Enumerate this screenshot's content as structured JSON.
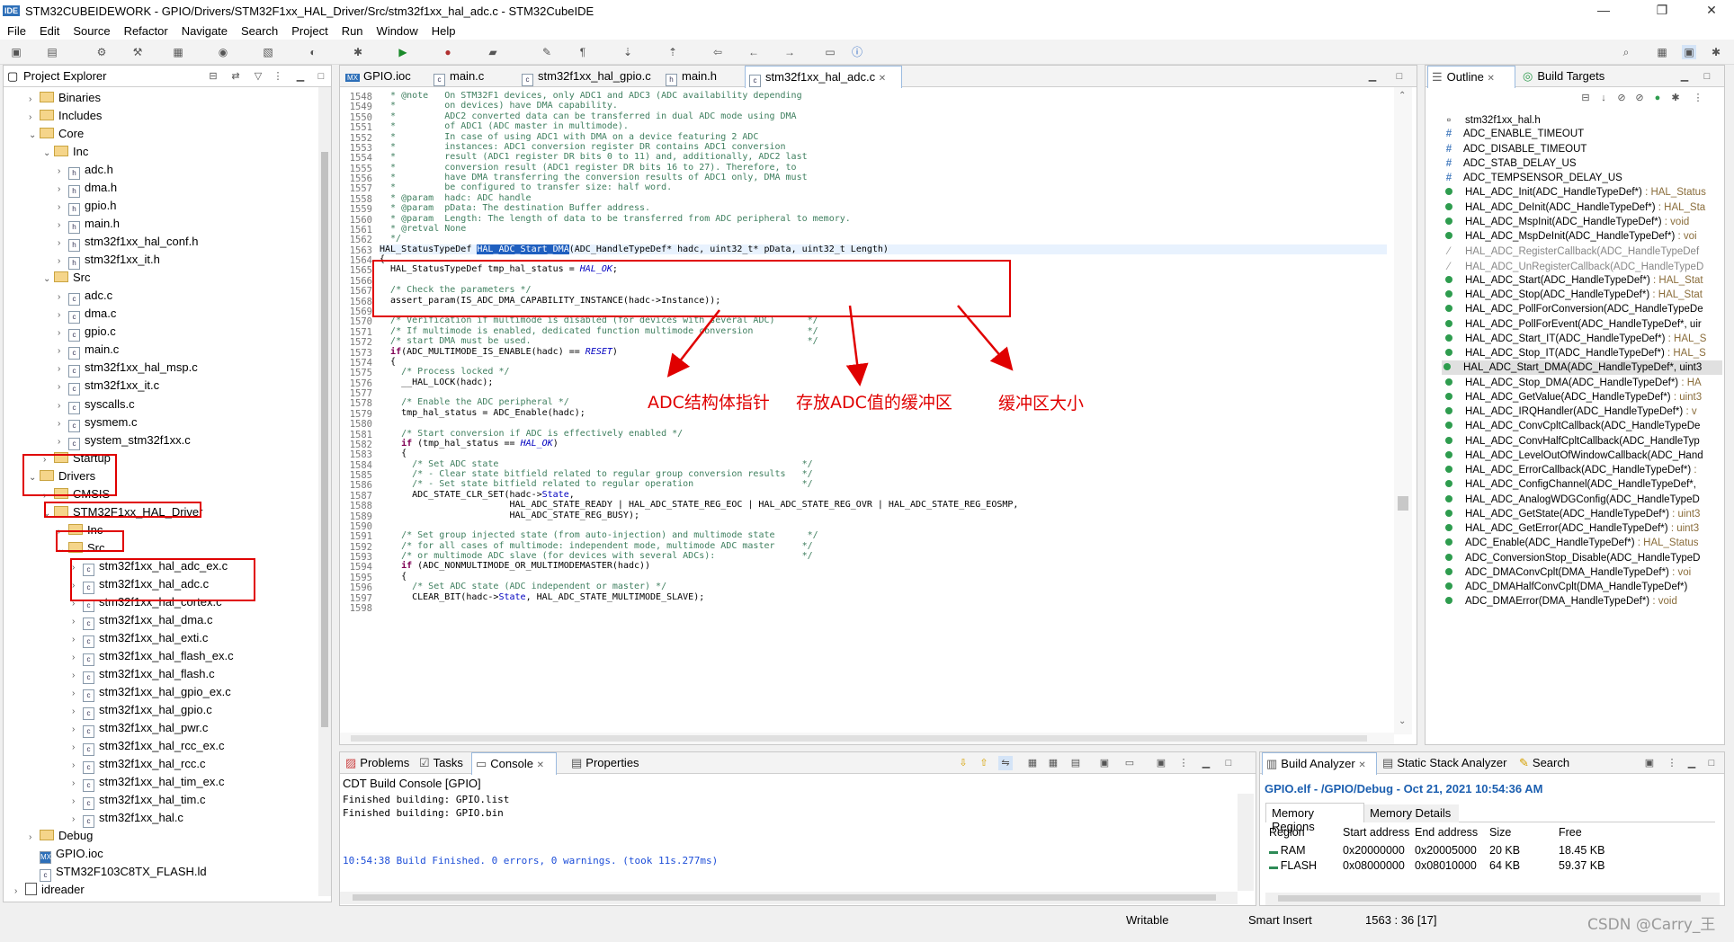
{
  "window": {
    "ide_badge": "IDE",
    "title": "STM32CUBEIDEWORK - GPIO/Drivers/STM32F1xx_HAL_Driver/Src/stm32f1xx_hal_adc.c - STM32CubeIDE",
    "minimize": "—",
    "restore": "❐",
    "close": "✕"
  },
  "menu": [
    "File",
    "Edit",
    "Source",
    "Refactor",
    "Navigate",
    "Search",
    "Project",
    "Run",
    "Window",
    "Help"
  ],
  "project_explorer": {
    "title": "Project Explorer",
    "items": [
      {
        "label": "Binaries",
        "depth": 1,
        "kind": "folder",
        "tw": "›"
      },
      {
        "label": "Includes",
        "depth": 1,
        "kind": "folder",
        "tw": "›"
      },
      {
        "label": "Core",
        "depth": 1,
        "kind": "folder",
        "tw": "⌄"
      },
      {
        "label": "Inc",
        "depth": 2,
        "kind": "folder",
        "tw": "⌄"
      },
      {
        "label": "adc.h",
        "depth": 3,
        "kind": "h",
        "tw": "›"
      },
      {
        "label": "dma.h",
        "depth": 3,
        "kind": "h",
        "tw": "›"
      },
      {
        "label": "gpio.h",
        "depth": 3,
        "kind": "h",
        "tw": "›"
      },
      {
        "label": "main.h",
        "depth": 3,
        "kind": "h",
        "tw": "›"
      },
      {
        "label": "stm32f1xx_hal_conf.h",
        "depth": 3,
        "kind": "h",
        "tw": "›"
      },
      {
        "label": "stm32f1xx_it.h",
        "depth": 3,
        "kind": "h",
        "tw": "›"
      },
      {
        "label": "Src",
        "depth": 2,
        "kind": "folder",
        "tw": "⌄"
      },
      {
        "label": "adc.c",
        "depth": 3,
        "kind": "c",
        "tw": "›"
      },
      {
        "label": "dma.c",
        "depth": 3,
        "kind": "c",
        "tw": "›"
      },
      {
        "label": "gpio.c",
        "depth": 3,
        "kind": "c",
        "tw": "›"
      },
      {
        "label": "main.c",
        "depth": 3,
        "kind": "c",
        "tw": "›"
      },
      {
        "label": "stm32f1xx_hal_msp.c",
        "depth": 3,
        "kind": "c",
        "tw": "›"
      },
      {
        "label": "stm32f1xx_it.c",
        "depth": 3,
        "kind": "c",
        "tw": "›"
      },
      {
        "label": "syscalls.c",
        "depth": 3,
        "kind": "c",
        "tw": "›"
      },
      {
        "label": "sysmem.c",
        "depth": 3,
        "kind": "c",
        "tw": "›"
      },
      {
        "label": "system_stm32f1xx.c",
        "depth": 3,
        "kind": "c",
        "tw": "›"
      },
      {
        "label": "Startup",
        "depth": 2,
        "kind": "folder",
        "tw": "›"
      },
      {
        "label": "Drivers",
        "depth": 1,
        "kind": "folder",
        "tw": "⌄"
      },
      {
        "label": "CMSIS",
        "depth": 2,
        "kind": "folder",
        "tw": "›"
      },
      {
        "label": "STM32F1xx_HAL_Driver",
        "depth": 2,
        "kind": "folder",
        "tw": "⌄"
      },
      {
        "label": "Inc",
        "depth": 3,
        "kind": "folder",
        "tw": "›"
      },
      {
        "label": "Src",
        "depth": 3,
        "kind": "folder",
        "tw": "⌄"
      },
      {
        "label": "stm32f1xx_hal_adc_ex.c",
        "depth": 4,
        "kind": "c",
        "tw": "›"
      },
      {
        "label": "stm32f1xx_hal_adc.c",
        "depth": 4,
        "kind": "c",
        "tw": "›"
      },
      {
        "label": "stm32f1xx_hal_cortex.c",
        "depth": 4,
        "kind": "c",
        "tw": "›"
      },
      {
        "label": "stm32f1xx_hal_dma.c",
        "depth": 4,
        "kind": "c",
        "tw": "›"
      },
      {
        "label": "stm32f1xx_hal_exti.c",
        "depth": 4,
        "kind": "c",
        "tw": "›"
      },
      {
        "label": "stm32f1xx_hal_flash_ex.c",
        "depth": 4,
        "kind": "c",
        "tw": "›"
      },
      {
        "label": "stm32f1xx_hal_flash.c",
        "depth": 4,
        "kind": "c",
        "tw": "›"
      },
      {
        "label": "stm32f1xx_hal_gpio_ex.c",
        "depth": 4,
        "kind": "c",
        "tw": "›"
      },
      {
        "label": "stm32f1xx_hal_gpio.c",
        "depth": 4,
        "kind": "c",
        "tw": "›"
      },
      {
        "label": "stm32f1xx_hal_pwr.c",
        "depth": 4,
        "kind": "c",
        "tw": "›"
      },
      {
        "label": "stm32f1xx_hal_rcc_ex.c",
        "depth": 4,
        "kind": "c",
        "tw": "›"
      },
      {
        "label": "stm32f1xx_hal_rcc.c",
        "depth": 4,
        "kind": "c",
        "tw": "›"
      },
      {
        "label": "stm32f1xx_hal_tim_ex.c",
        "depth": 4,
        "kind": "c",
        "tw": "›"
      },
      {
        "label": "stm32f1xx_hal_tim.c",
        "depth": 4,
        "kind": "c",
        "tw": "›"
      },
      {
        "label": "stm32f1xx_hal.c",
        "depth": 4,
        "kind": "c",
        "tw": "›"
      },
      {
        "label": "Debug",
        "depth": 1,
        "kind": "folder",
        "tw": "›"
      },
      {
        "label": "GPIO.ioc",
        "depth": 1,
        "kind": "mx",
        "tw": ""
      },
      {
        "label": "STM32F103C8TX_FLASH.ld",
        "depth": 1,
        "kind": "c",
        "tw": ""
      },
      {
        "label": "idreader",
        "depth": 0,
        "kind": "project",
        "tw": "›"
      }
    ]
  },
  "editor": {
    "tabs": [
      {
        "icon": "MX",
        "label": "GPIO.ioc"
      },
      {
        "icon": "c",
        "label": "main.c"
      },
      {
        "icon": "c",
        "label": "stm32f1xx_hal_gpio.c"
      },
      {
        "icon": "h",
        "label": "main.h"
      },
      {
        "icon": "c",
        "label": "stm32f1xx_hal_adc.c",
        "close": "✕"
      }
    ],
    "lines": [
      {
        "n": "1548",
        "html": "<span class='c'>  * @note   On STM32F1 devices, only ADC1 and ADC3 (ADC availability depending</span>"
      },
      {
        "n": "1549",
        "html": "<span class='c'>  *         on devices) have DMA capability.</span>"
      },
      {
        "n": "1550",
        "html": "<span class='c'>  *         ADC2 converted data can be transferred in dual ADC mode using DMA</span>"
      },
      {
        "n": "1551",
        "html": "<span class='c'>  *         of ADC1 (ADC master in multimode).</span>"
      },
      {
        "n": "1552",
        "html": "<span class='c'>  *         In case of using ADC1 with DMA on a device featuring 2 ADC</span>"
      },
      {
        "n": "1553",
        "html": "<span class='c'>  *         instances: ADC1 conversion register DR contains ADC1 conversion</span>"
      },
      {
        "n": "1554",
        "html": "<span class='c'>  *         result (ADC1 register DR bits 0 to 11) and, additionally, ADC2 last</span>"
      },
      {
        "n": "1555",
        "html": "<span class='c'>  *         conversion result (ADC1 register DR bits 16 to 27). Therefore, to</span>"
      },
      {
        "n": "1556",
        "html": "<span class='c'>  *         have DMA transferring the conversion results of ADC1 only, DMA must</span>"
      },
      {
        "n": "1557",
        "html": "<span class='c'>  *         be configured to transfer size: half word.</span>"
      },
      {
        "n": "1558",
        "html": "<span class='c'>  * @param  hadc: ADC handle</span>"
      },
      {
        "n": "1559",
        "html": "<span class='c'>  * @param  pData: The destination Buffer address.</span>"
      },
      {
        "n": "1560",
        "html": "<span class='c'>  * @param  Length: The length of data to be transferred from ADC peripheral to memory.</span>"
      },
      {
        "n": "1561",
        "html": "<span class='c'>  * @retval None</span>"
      },
      {
        "n": "1562",
        "html": "<span class='c'>  */</span>"
      },
      {
        "n": "1563",
        "html": "HAL_StatusTypeDef <span style='background:#1f5fbf;color:#fff'>HAL_ADC_Start_DMA</span>(ADC_HandleTypeDef* hadc, uint32_t* pData, uint32_t Length)"
      },
      {
        "n": "1564",
        "html": "{"
      },
      {
        "n": "1565",
        "html": "  HAL_StatusTypeDef tmp_hal_status = <span class='m'>HAL_OK</span>;"
      },
      {
        "n": "1566",
        "html": ""
      },
      {
        "n": "1567",
        "html": "  <span class='c'>/* Check the parameters */</span>"
      },
      {
        "n": "1568",
        "html": "  assert_param(IS_ADC_DMA_CAPABILITY_INSTANCE(hadc-&gt;Instance));"
      },
      {
        "n": "1569",
        "html": ""
      },
      {
        "n": "1570",
        "html": "  <span class='c'>/* Verification if multimode is disabled (for devices with several ADC)      */</span>"
      },
      {
        "n": "1571",
        "html": "  <span class='c'>/* If multimode is enabled, dedicated function multimode conversion          */</span>"
      },
      {
        "n": "1572",
        "html": "  <span class='c'>/* start DMA must be used.                                                   */</span>"
      },
      {
        "n": "1573",
        "html": "  <span class='k'>if</span>(ADC_MULTIMODE_IS_ENABLE(hadc) == <span class='m'>RESET</span>)"
      },
      {
        "n": "1574",
        "html": "  {"
      },
      {
        "n": "1575",
        "html": "    <span class='c'>/* Process locked */</span>"
      },
      {
        "n": "1576",
        "html": "    __HAL_LOCK(hadc);"
      },
      {
        "n": "1577",
        "html": ""
      },
      {
        "n": "1578",
        "html": "    <span class='c'>/* Enable the ADC peripheral */</span>"
      },
      {
        "n": "1579",
        "html": "    tmp_hal_status = ADC_Enable(hadc);"
      },
      {
        "n": "1580",
        "html": ""
      },
      {
        "n": "1581",
        "html": "    <span class='c'>/* Start conversion if ADC is effectively enabled */</span>"
      },
      {
        "n": "1582",
        "html": "    <span class='k'>if</span> (tmp_hal_status == <span class='m'>HAL_OK</span>)"
      },
      {
        "n": "1583",
        "html": "    {"
      },
      {
        "n": "1584",
        "html": "      <span class='c'>/* Set ADC state                                                        */</span>"
      },
      {
        "n": "1585",
        "html": "      <span class='c'>/* - Clear state bitfield related to regular group conversion results   */</span>"
      },
      {
        "n": "1586",
        "html": "      <span class='c'>/* - Set state bitfield related to regular operation                    */</span>"
      },
      {
        "n": "1587",
        "html": "      ADC_STATE_CLR_SET(hadc-&gt;<span style='color:#0000c0'>State</span>,"
      },
      {
        "n": "1588",
        "html": "                        HAL_ADC_STATE_READY | HAL_ADC_STATE_REG_EOC | HAL_ADC_STATE_REG_OVR | HAL_ADC_STATE_REG_EOSMP,"
      },
      {
        "n": "1589",
        "html": "                        HAL_ADC_STATE_REG_BUSY);"
      },
      {
        "n": "1590",
        "html": ""
      },
      {
        "n": "1591",
        "html": "    <span class='c'>/* Set group injected state (from auto-injection) and multimode state      */</span>"
      },
      {
        "n": "1592",
        "html": "    <span class='c'>/* for all cases of multimode: independent mode, multimode ADC master     */</span>"
      },
      {
        "n": "1593",
        "html": "    <span class='c'>/* or multimode ADC slave (for devices with several ADCs):                */</span>"
      },
      {
        "n": "1594",
        "html": "    <span class='k'>if</span> (ADC_NONMULTIMODE_OR_MULTIMODEMASTER(hadc))"
      },
      {
        "n": "1595",
        "html": "    {"
      },
      {
        "n": "1596",
        "html": "      <span class='c'>/* Set ADC state (ADC independent or master) */</span>"
      },
      {
        "n": "1597",
        "html": "      CLEAR_BIT(hadc-&gt;<span style='color:#0000c0'>State</span>, HAL_ADC_STATE_MULTIMODE_SLAVE);"
      },
      {
        "n": "1598",
        "html": ""
      }
    ]
  },
  "annotations": {
    "a1": "ADC结构体指针",
    "a2": "存放ADC值的缓冲区",
    "a3": "缓冲区大小"
  },
  "outline": {
    "tab1": "Outline",
    "tab2": "Build Targets",
    "items": [
      {
        "kind": "include",
        "label": "stm32f1xx_hal.h",
        "type": ""
      },
      {
        "kind": "macro",
        "label": "ADC_ENABLE_TIMEOUT",
        "type": ""
      },
      {
        "kind": "macro",
        "label": "ADC_DISABLE_TIMEOUT",
        "type": ""
      },
      {
        "kind": "macro",
        "label": "ADC_STAB_DELAY_US",
        "type": ""
      },
      {
        "kind": "macro",
        "label": "ADC_TEMPSENSOR_DELAY_US",
        "type": ""
      },
      {
        "kind": "fn",
        "label": "HAL_ADC_Init(ADC_HandleTypeDef*)",
        "type": " : HAL_Status"
      },
      {
        "kind": "fn",
        "label": "HAL_ADC_DeInit(ADC_HandleTypeDef*)",
        "type": " : HAL_Sta"
      },
      {
        "kind": "fn",
        "label": "HAL_ADC_MspInit(ADC_HandleTypeDef*)",
        "type": " : void"
      },
      {
        "kind": "fn",
        "label": "HAL_ADC_MspDeInit(ADC_HandleTypeDef*)",
        "type": " : voi"
      },
      {
        "kind": "inactive",
        "label": "HAL_ADC_RegisterCallback(ADC_HandleTypeDef",
        "type": ""
      },
      {
        "kind": "inactive",
        "label": "HAL_ADC_UnRegisterCallback(ADC_HandleTypeD",
        "type": ""
      },
      {
        "kind": "fn",
        "label": "HAL_ADC_Start(ADC_HandleTypeDef*)",
        "type": " : HAL_Stat"
      },
      {
        "kind": "fn",
        "label": "HAL_ADC_Stop(ADC_HandleTypeDef*)",
        "type": " : HAL_Stat"
      },
      {
        "kind": "fn",
        "label": "HAL_ADC_PollForConversion(ADC_HandleTypeDe",
        "type": ""
      },
      {
        "kind": "fn",
        "label": "HAL_ADC_PollForEvent(ADC_HandleTypeDef*, uir",
        "type": ""
      },
      {
        "kind": "fn",
        "label": "HAL_ADC_Start_IT(ADC_HandleTypeDef*)",
        "type": " : HAL_S"
      },
      {
        "kind": "fn",
        "label": "HAL_ADC_Stop_IT(ADC_HandleTypeDef*)",
        "type": " : HAL_S"
      },
      {
        "kind": "fn-sel",
        "label": "HAL_ADC_Start_DMA(ADC_HandleTypeDef*, uint3",
        "type": ""
      },
      {
        "kind": "fn",
        "label": "HAL_ADC_Stop_DMA(ADC_HandleTypeDef*)",
        "type": " : HA"
      },
      {
        "kind": "fn",
        "label": "HAL_ADC_GetValue(ADC_HandleTypeDef*)",
        "type": " : uint3"
      },
      {
        "kind": "fn",
        "label": "HAL_ADC_IRQHandler(ADC_HandleTypeDef*)",
        "type": " : v"
      },
      {
        "kind": "fn",
        "label": "HAL_ADC_ConvCpltCallback(ADC_HandleTypeDe",
        "type": ""
      },
      {
        "kind": "fn",
        "label": "HAL_ADC_ConvHalfCpltCallback(ADC_HandleTyp",
        "type": ""
      },
      {
        "kind": "fn",
        "label": "HAL_ADC_LevelOutOfWindowCallback(ADC_Hand",
        "type": ""
      },
      {
        "kind": "fn",
        "label": "HAL_ADC_ErrorCallback(ADC_HandleTypeDef*)",
        "type": " :"
      },
      {
        "kind": "fn",
        "label": "HAL_ADC_ConfigChannel(ADC_HandleTypeDef*,",
        "type": ""
      },
      {
        "kind": "fn",
        "label": "HAL_ADC_AnalogWDGConfig(ADC_HandleTypeD",
        "type": ""
      },
      {
        "kind": "fn",
        "label": "HAL_ADC_GetState(ADC_HandleTypeDef*)",
        "type": " : uint3"
      },
      {
        "kind": "fn",
        "label": "HAL_ADC_GetError(ADC_HandleTypeDef*)",
        "type": " : uint3"
      },
      {
        "kind": "fn",
        "label": "ADC_Enable(ADC_HandleTypeDef*)",
        "type": " : HAL_Status"
      },
      {
        "kind": "fn",
        "label": "ADC_ConversionStop_Disable(ADC_HandleTypeD",
        "type": ""
      },
      {
        "kind": "fn",
        "label": "ADC_DMAConvCplt(DMA_HandleTypeDef*)",
        "type": " : voi"
      },
      {
        "kind": "fn",
        "label": "ADC_DMAHalfConvCplt(DMA_HandleTypeDef*)",
        "type": ""
      },
      {
        "kind": "fn",
        "label": "ADC_DMAError(DMA_HandleTypeDef*)",
        "type": " : void"
      }
    ]
  },
  "console": {
    "tabs": [
      "Problems",
      "Tasks",
      "Console",
      "Properties"
    ],
    "header": "CDT Build Console [GPIO]",
    "lines": [
      "Finished building: GPIO.list",
      "Finished building: GPIO.bin"
    ],
    "result": "10:54:38 Build Finished. 0 errors, 0 warnings. (took 11s.277ms)"
  },
  "build_analyzer": {
    "tabs": [
      "Build Analyzer",
      "Static Stack Analyzer",
      "Search"
    ],
    "header": "GPIO.elf - /GPIO/Debug - Oct 21, 2021 10:54:36 AM",
    "subtabs": [
      "Memory Regions",
      "Memory Details"
    ],
    "columns": [
      "Region",
      "Start address",
      "End address",
      "Size",
      "Free"
    ],
    "rows": [
      [
        "RAM",
        "0x20000000",
        "0x20005000",
        "20 KB",
        "18.45 KB"
      ],
      [
        "FLASH",
        "0x08000000",
        "0x08010000",
        "64 KB",
        "59.37 KB"
      ]
    ]
  },
  "status": {
    "writable": "Writable",
    "insert": "Smart Insert",
    "position": "1563 : 36 [17]",
    "watermark": "CSDN @Carry_王"
  }
}
